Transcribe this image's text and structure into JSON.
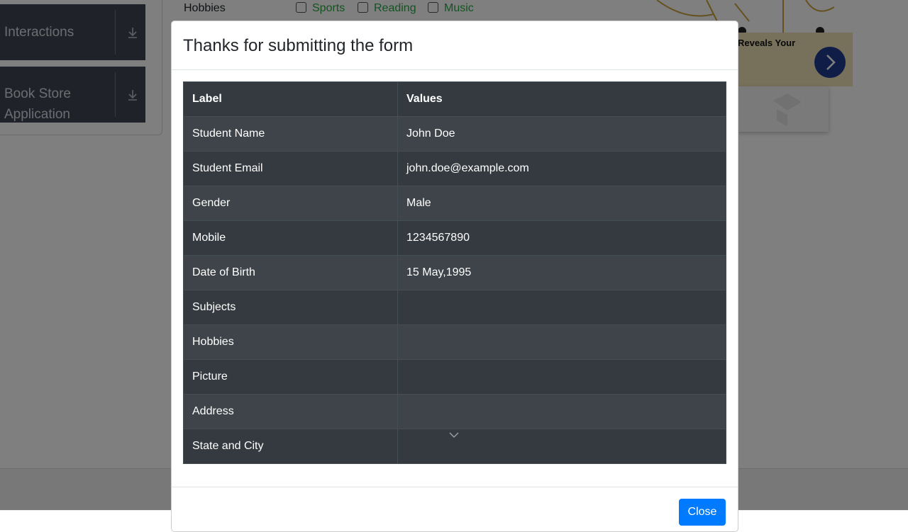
{
  "background": {
    "sidebar": [
      {
        "label": "Interactions"
      },
      {
        "label_line1": "Book Store",
        "label_line2": "Application"
      }
    ],
    "hobbies": {
      "label": "Hobbies",
      "options": [
        "Sports",
        "Reading",
        "Music"
      ]
    },
    "ad": {
      "text": "Reveals Your"
    }
  },
  "modal": {
    "title": "Thanks for submitting the form",
    "table": {
      "headers": [
        "Label",
        "Values"
      ],
      "rows": [
        {
          "label": "Student Name",
          "value": "John Doe"
        },
        {
          "label": "Student Email",
          "value": "john.doe@example.com"
        },
        {
          "label": "Gender",
          "value": "Male"
        },
        {
          "label": "Mobile",
          "value": "1234567890"
        },
        {
          "label": "Date of Birth",
          "value": "15 May,1995"
        },
        {
          "label": "Subjects",
          "value": ""
        },
        {
          "label": "Hobbies",
          "value": ""
        },
        {
          "label": "Picture",
          "value": ""
        },
        {
          "label": "Address",
          "value": ""
        },
        {
          "label": "State and City",
          "value": ""
        }
      ]
    },
    "close_label": "Close"
  },
  "colors": {
    "table_header": "#343a40",
    "table_row_alt": "#3e444a",
    "primary_button": "#007bff",
    "hobby_text": "#28a745"
  }
}
